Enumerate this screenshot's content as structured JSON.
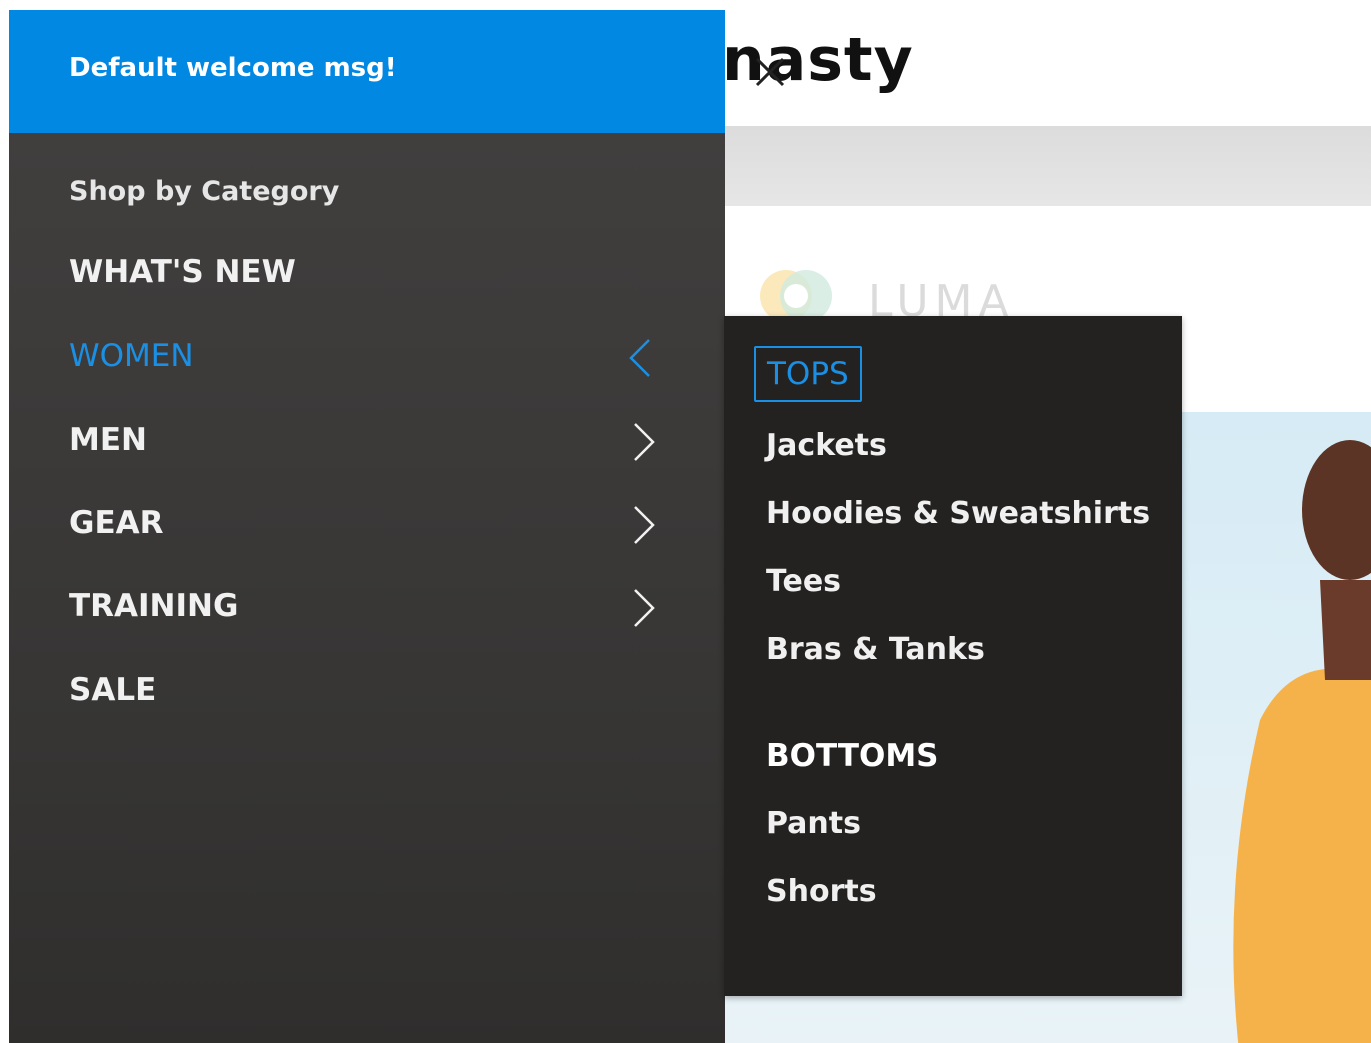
{
  "background": {
    "logo_text": "nasty",
    "luma_text": "LUMA"
  },
  "drawer": {
    "welcome": "Default welcome msg!",
    "section_label": "Shop by Category",
    "items": [
      {
        "label": "WHAT'S NEW",
        "has_children": false,
        "active": false
      },
      {
        "label": "WOMEN",
        "has_children": true,
        "active": true
      },
      {
        "label": "MEN",
        "has_children": true,
        "active": false
      },
      {
        "label": "GEAR",
        "has_children": true,
        "active": false
      },
      {
        "label": "TRAINING",
        "has_children": true,
        "active": false
      },
      {
        "label": "SALE",
        "has_children": false,
        "active": false
      }
    ]
  },
  "submenu": {
    "groups": [
      {
        "heading": "TOPS",
        "links": [
          "Jackets",
          "Hoodies & Sweatshirts",
          "Tees",
          "Bras & Tanks"
        ]
      },
      {
        "heading": "BOTTOMS",
        "links": [
          "Pants",
          "Shorts"
        ]
      }
    ]
  },
  "colors": {
    "header_blue": "#0088e3",
    "accent_blue": "#1a8fe3",
    "drawer_bg": "#3c3a39",
    "submenu_bg": "#242221"
  }
}
